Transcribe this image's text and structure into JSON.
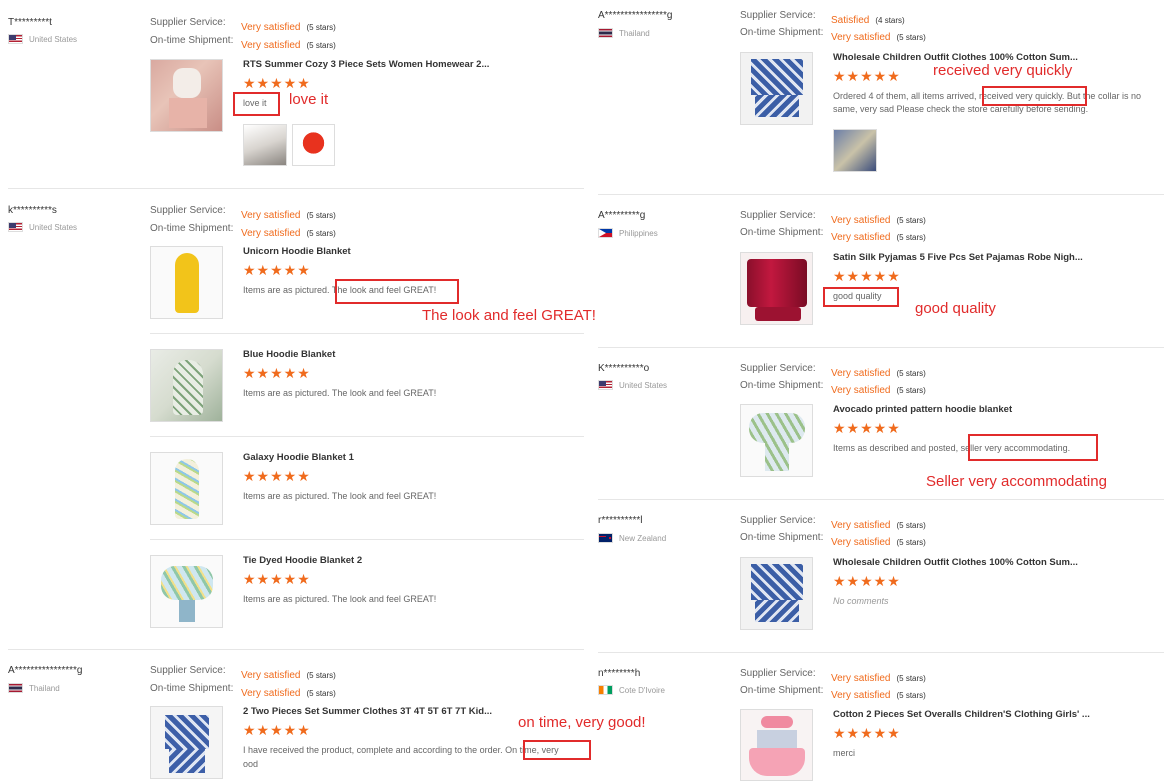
{
  "labels": {
    "supplier_service": "Supplier Service:",
    "ontime_shipment": "On-time Shipment:",
    "no_comments": "No comments"
  },
  "colors": {
    "accent": "#f06b1d",
    "annotation": "#e12b2b"
  },
  "left": [
    {
      "reviewer": "T*********t",
      "country": "United States",
      "supplier": {
        "value": "Very satisfied",
        "stars": "(5 stars)"
      },
      "shipment": {
        "value": "Very satisfied",
        "stars": "(5 stars)"
      },
      "products": [
        {
          "title": "RTS Summer Cozy 3 Piece Sets Women Homewear 2...",
          "rating": "★★★★★",
          "text": "love it"
        }
      ],
      "annotation": "love it"
    },
    {
      "reviewer": "k**********s",
      "country": "United States",
      "supplier": {
        "value": "Very satisfied",
        "stars": "(5 stars)"
      },
      "shipment": {
        "value": "Very satisfied",
        "stars": "(5 stars)"
      },
      "products": [
        {
          "title": "Unicorn Hoodie Blanket",
          "rating": "★★★★★",
          "text": "Items are as pictured. The look and feel GREAT!"
        },
        {
          "title": "Blue Hoodie Blanket",
          "rating": "★★★★★",
          "text": "Items are as pictured. The look and feel GREAT!"
        },
        {
          "title": "Galaxy Hoodie Blanket 1",
          "rating": "★★★★★",
          "text": "Items are as pictured. The look and feel GREAT!"
        },
        {
          "title": "Tie Dyed Hoodie Blanket 2",
          "rating": "★★★★★",
          "text": "Items are as pictured. The look and feel GREAT!"
        }
      ],
      "annotation": "The look and feel GREAT!"
    },
    {
      "reviewer": "A****************g",
      "country": "Thailand",
      "supplier": {
        "value": "Very satisfied",
        "stars": "(5 stars)"
      },
      "shipment": {
        "value": "Very satisfied",
        "stars": "(5 stars)"
      },
      "products": [
        {
          "title": "2 Two Pieces Set Summer Clothes 3T 4T 5T 6T 7T Kid...",
          "rating": "★★★★★",
          "text": "I have received the product, complete and according to the order. On time, very",
          "text2": "ood"
        }
      ],
      "annotation": "on time, very good!"
    }
  ],
  "right": [
    {
      "reviewer": "A****************g",
      "country": "Thailand",
      "supplier": {
        "value": "Satisfied",
        "stars": "(4 stars)"
      },
      "shipment": {
        "value": "Very satisfied",
        "stars": "(5 stars)"
      },
      "products": [
        {
          "title": "Wholesale Children Outfit Clothes 100% Cotton Sum...",
          "rating": "★★★★★",
          "text": "Ordered 4 of them, all items arrived, received very quickly. But the collar is no",
          "text2": "same, very sad  Please check the store carefully before sending."
        }
      ],
      "annotation": "received very quickly"
    },
    {
      "reviewer": "A*********g",
      "country": "Philippines",
      "supplier": {
        "value": "Very satisfied",
        "stars": "(5 stars)"
      },
      "shipment": {
        "value": "Very satisfied",
        "stars": "(5 stars)"
      },
      "products": [
        {
          "title": "Satin Silk Pyjamas 5 Five Pcs Set Pajamas Robe Nigh...",
          "rating": "★★★★★",
          "text": "good quality"
        }
      ],
      "annotation": "good quality"
    },
    {
      "reviewer": "K**********o",
      "country": "United States",
      "supplier": {
        "value": "Very satisfied",
        "stars": "(5 stars)"
      },
      "shipment": {
        "value": "Very satisfied",
        "stars": "(5 stars)"
      },
      "products": [
        {
          "title": "Avocado printed pattern hoodie blanket",
          "rating": "★★★★★",
          "text": "Items as described and posted, seller very accommodating."
        }
      ],
      "annotation": "Seller very accommodating"
    },
    {
      "reviewer": "r**********l",
      "country": "New Zealand",
      "supplier": {
        "value": "Very satisfied",
        "stars": "(5 stars)"
      },
      "shipment": {
        "value": "Very satisfied",
        "stars": "(5 stars)"
      },
      "products": [
        {
          "title": "Wholesale Children Outfit Clothes 100% Cotton Sum...",
          "rating": "★★★★★"
        }
      ]
    },
    {
      "reviewer": "n********h",
      "country": "Cote D'Ivoire",
      "supplier": {
        "value": "Very satisfied",
        "stars": "(5 stars)"
      },
      "shipment": {
        "value": "Very satisfied",
        "stars": "(5 stars)"
      },
      "products": [
        {
          "title": "Cotton 2 Pieces Set Overalls Children'S Clothing Girls' ...",
          "rating": "★★★★★",
          "text": "merci"
        }
      ]
    }
  ]
}
